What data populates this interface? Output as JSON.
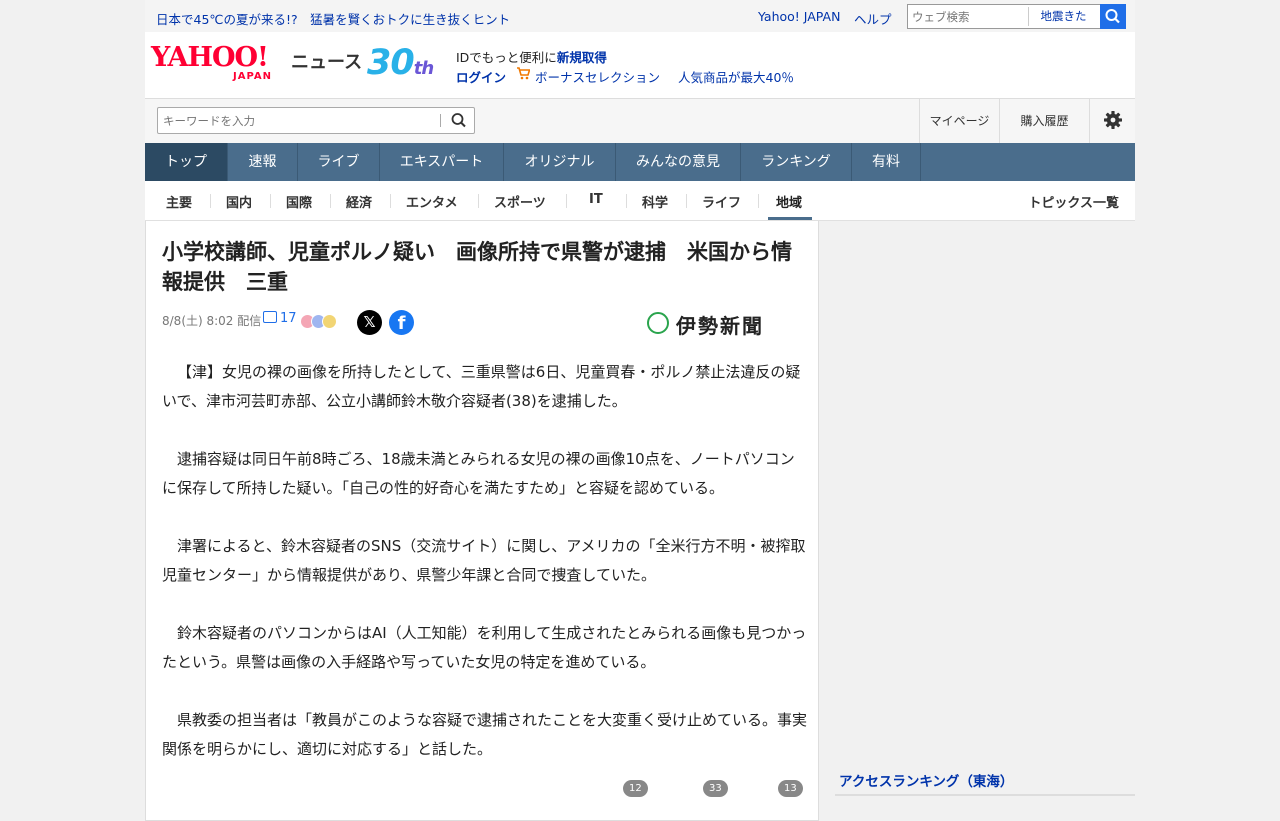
{
  "topbar": {
    "promo": "日本で45℃の夏が来る!?　猛暑を賢くおトクに生き抜くヒント",
    "yahoo_japan": "Yahoo! JAPAN",
    "help": "ヘルプ",
    "web_search_placeholder": "ウェブ検索",
    "web_search_chip": "地震きた"
  },
  "header": {
    "logo_yahoo": "YAHOO!",
    "logo_japan": "JAPAN",
    "logo_news": "ニュース",
    "logo_30": "30",
    "logo_th": "th",
    "id_promo_prefix": "IDでもっと便利に",
    "id_promo_link": "新規取得",
    "login": "ログイン",
    "bonus": "ボーナスセレクション",
    "popular": "人気商品が最大40％"
  },
  "search": {
    "placeholder": "キーワードを入力",
    "mypage": "マイページ",
    "history": "購入履歴"
  },
  "nav": {
    "tabs": [
      "トップ",
      "速報",
      "ライブ",
      "エキスパート",
      "オリジナル",
      "みんなの意見",
      "ランキング",
      "有料"
    ],
    "active": "トップ"
  },
  "subnav": {
    "items": [
      "主要",
      "国内",
      "国際",
      "経済",
      "エンタメ",
      "スポーツ",
      "IT",
      "科学",
      "ライフ",
      "地域"
    ],
    "active": "地域",
    "topics_all": "トピックス一覧"
  },
  "article": {
    "title": "小学校講師、児童ポルノ疑い　画像所持で県警が逮捕　米国から情報提供　三重",
    "meta": "8/8(土) 8:02 配信",
    "comment_count": "17",
    "publisher": "伊勢新聞",
    "paragraphs": [
      "【津】女児の裸の画像を所持したとして、三重県警は6日、児童買春・ポルノ禁止法違反の疑いで、津市河芸町赤部、公立小講師鈴木敬介容疑者(38)を逮捕した。",
      "逮捕容疑は同日午前8時ごろ、18歳未満とみられる女児の裸の画像10点を、ノートパソコンに保存して所持した疑い。「自己の性的好奇心を満たすため」と容疑を認めている。",
      "津署によると、鈴木容疑者のSNS（交流サイト）に関し、アメリカの「全米行方不明・被搾取児童センター」から情報提供があり、県警少年課と合同で捜査していた。",
      "鈴木容疑者のパソコンからはAI（人工知能）を利用して生成されたとみられる画像も見つかったという。県警は画像の入手経路や写っていた女児の特定を進めている。",
      "県教委の担当者は「教員がこのような容疑で逮捕されたことを大変重く受け止めている。事実関係を明らかにし、適切に対応する」と話した。"
    ],
    "reaction_counts": [
      "12",
      "33",
      "13"
    ]
  },
  "sidebar": {
    "ranking_title": "アクセスランキング（東海）"
  },
  "colors": {
    "nav_bg": "#4a6d8c",
    "link": "#0033aa",
    "brand_red": "#ff0033",
    "search_blue": "#1f6ee8"
  }
}
